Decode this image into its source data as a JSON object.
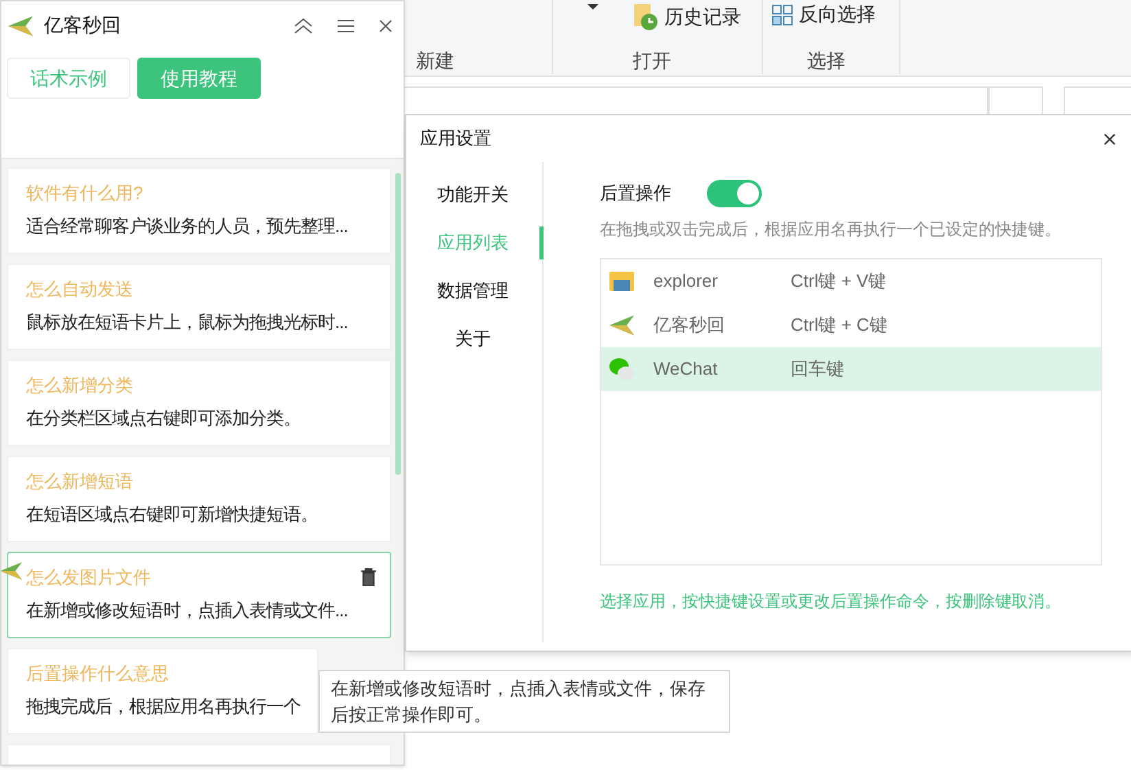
{
  "explorer_ribbon": {
    "commands": [
      {
        "label": "历史记录"
      },
      {
        "label": "反向选择"
      }
    ],
    "groups": [
      "新建",
      "打开",
      "选择"
    ]
  },
  "left_panel": {
    "title": "亿客秒回",
    "tabs": [
      {
        "label": "话术示例",
        "selected": false
      },
      {
        "label": "使用教程",
        "selected": true
      }
    ],
    "cards": [
      {
        "title": "软件有什么用?",
        "text": "适合经常聊客户谈业务的人员，预先整理...",
        "selected": false
      },
      {
        "title": "怎么自动发送",
        "text": "鼠标放在短语卡片上，鼠标为拖拽光标时...",
        "selected": false
      },
      {
        "title": "怎么新增分类",
        "text": "在分类栏区域点右键即可添加分类。",
        "selected": false
      },
      {
        "title": "怎么新增短语",
        "text": "在短语区域点右键即可新增快捷短语。",
        "selected": false
      },
      {
        "title": "怎么发图片文件",
        "text": "在新增或修改短语时，点插入表情或文件...",
        "selected": true
      },
      {
        "title": "后置操作什么意思",
        "text": "拖拽完成后，根据应用名再执行一个",
        "selected": false
      }
    ]
  },
  "settings_dialog": {
    "title": "应用设置",
    "nav": [
      {
        "label": "功能开关",
        "selected": false
      },
      {
        "label": "应用列表",
        "selected": true
      },
      {
        "label": "数据管理",
        "selected": false
      },
      {
        "label": "关于",
        "selected": false
      }
    ],
    "post_action": {
      "label": "后置操作",
      "on": true,
      "description": "在拖拽或双击完成后，根据应用名再执行一个已设定的快捷键。"
    },
    "apps": [
      {
        "kind": "folder",
        "name": "explorer",
        "shortcut": "Ctrl键 + V键",
        "selected": false
      },
      {
        "kind": "logo",
        "name": "亿客秒回",
        "shortcut": "Ctrl键 + C键",
        "selected": false
      },
      {
        "kind": "chat",
        "name": "WeChat",
        "shortcut": "回车键",
        "selected": true
      }
    ],
    "hint": "选择应用，按快捷键设置或更改后置操作命令，按删除键取消。"
  },
  "tooltip": {
    "lines": [
      "在新增或修改短语时，点插入表情或文件，保存",
      "后按正常操作即可。"
    ]
  }
}
